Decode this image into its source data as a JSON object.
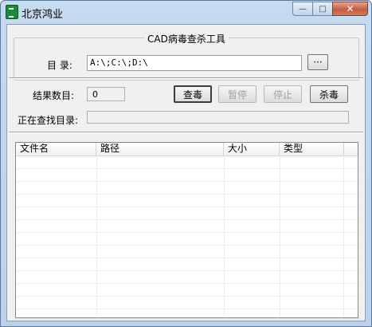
{
  "window": {
    "title": "北京鸿业",
    "minimize_glyph": "—",
    "maximize_glyph": "□",
    "close_glyph": "✕"
  },
  "group": {
    "title": "CAD病毒查杀工具",
    "dir_label": "目 录:",
    "dir_value": "A:\\;C:\\;D:\\",
    "browse_label": "···"
  },
  "scan": {
    "result_label": "结果数目:",
    "result_value": "0",
    "scanning_label": "正在查找目录:",
    "scanning_value": ""
  },
  "buttons": {
    "scan": "查毒",
    "pause": "暂停",
    "stop": "停止",
    "kill": "杀毒"
  },
  "table": {
    "columns": [
      "文件名",
      "路径",
      "大小",
      "类型"
    ],
    "rows": []
  },
  "icons": {
    "app": "app-logo-icon"
  }
}
